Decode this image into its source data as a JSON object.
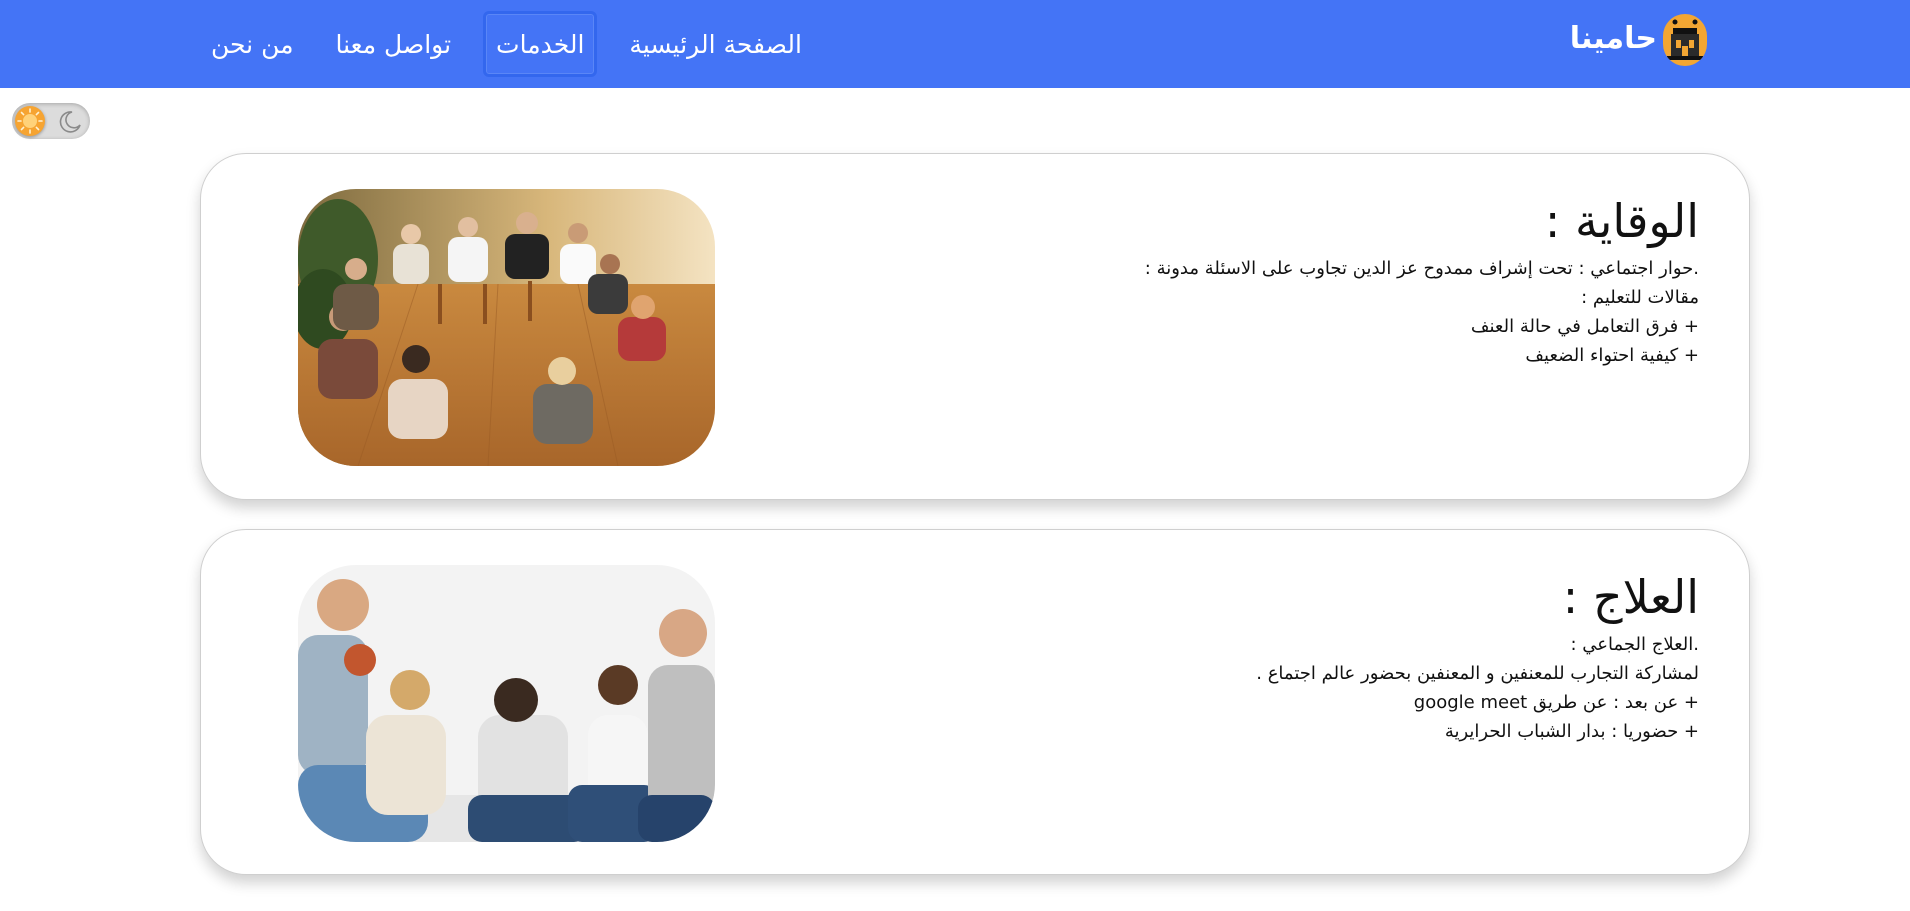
{
  "header": {
    "brand_name": "حامينا",
    "logo_icon": "building-mosque-icon",
    "nav": [
      {
        "label": "الصفحة الرئيسية",
        "active": false
      },
      {
        "label": "الخدمات",
        "active": true
      },
      {
        "label": "تواصل معنا",
        "active": false
      },
      {
        "label": "من نحن",
        "active": false
      }
    ],
    "colors": {
      "navbar": "#4474f6",
      "accent": "#f3a633"
    }
  },
  "theme_toggle": {
    "icons": [
      "sun-icon",
      "moon-icon"
    ],
    "state": "light"
  },
  "cards": [
    {
      "title": "الوقاية :",
      "lines": [
        ".حوار اجتماعي : تحت إشراف ممدوح عز الدين تجاوب على الاسئلة مدونة :",
        "مقالات للتعليم :",
        "+ فرق التعامل في حالة العنف",
        "+ كيفية احتواء الضعيف"
      ],
      "image": "support-group-circle-photo"
    },
    {
      "title": "العلاج :",
      "lines": [
        ".العلاج الجماعي :",
        "لمشاركة التجارب للمعنفين و المعنفين بحضور عالم اجتماع .",
        "+ عن بعد : عن طريق google meet",
        "+ حضوريا : بدار الشباب الحرايرية"
      ],
      "image": "group-therapy-comforting-photo"
    }
  ]
}
